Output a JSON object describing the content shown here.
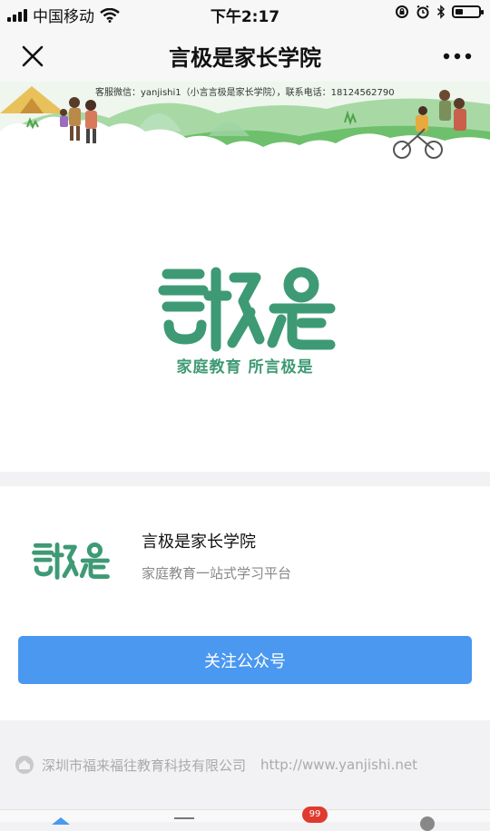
{
  "status_bar": {
    "carrier": "中国移动",
    "time": "下午2:17",
    "icons": [
      "signal-icon",
      "wifi-icon",
      "rotation-lock-icon",
      "alarm-icon",
      "bluetooth-icon",
      "battery-icon"
    ],
    "battery_level": 0.35
  },
  "nav": {
    "title": "言极是家长学院",
    "close_icon": "close-icon",
    "more_icon": "more-dots-icon"
  },
  "banner": {
    "contact_text": "客服微信：yanjishi1（小言言极是家长学院），联系电话：18124562790"
  },
  "logo": {
    "brand": "言极是",
    "slogan": "家庭教育  所言极是",
    "color": "#3e9a75"
  },
  "account": {
    "name": "言极是家长学院",
    "description": "家庭教育一站式学习平台",
    "follow_label": "关注公众号",
    "button_color": "#4a98f0"
  },
  "footer": {
    "company": "深圳市福来福往教育科技有限公司",
    "url": "http://www.yanjishi.net"
  },
  "tabbar": {
    "badge": "99"
  }
}
